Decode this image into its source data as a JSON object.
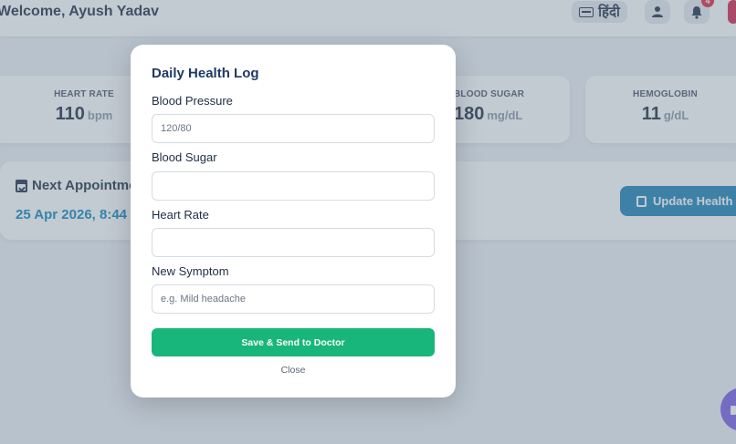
{
  "header": {
    "welcome": "Welcome, Ayush Yadav",
    "language_label": "हिंदी",
    "notification_count": "4"
  },
  "stats": [
    {
      "title": "HEART RATE",
      "value": "110",
      "unit": "bpm"
    },
    {
      "title": "BLOOD SUGAR",
      "value": "180",
      "unit": "mg/dL"
    },
    {
      "title": "HEMOGLOBIN",
      "value": "11",
      "unit": "g/dL"
    }
  ],
  "appointment": {
    "title": "Next Appointment",
    "date": "25 Apr 2026, 8:44"
  },
  "update_button": "Update Health",
  "modal": {
    "title": "Daily Health Log",
    "fields": [
      {
        "label": "Blood Pressure",
        "placeholder": "120/80"
      },
      {
        "label": "Blood Sugar",
        "placeholder": ""
      },
      {
        "label": "Heart Rate",
        "placeholder": ""
      },
      {
        "label": "New Symptom",
        "placeholder": "e.g. Mild headache"
      }
    ],
    "submit_label": "Save & Send to Doctor",
    "close_label": "Close"
  },
  "colors": {
    "primary": "#1c82b5",
    "success": "#18b67a",
    "heading": "#1f3a63",
    "danger": "#e0263c",
    "fab": "#7c5ce6"
  },
  "icons": [
    "keyboard-icon",
    "user-icon",
    "bell-icon",
    "calendar-check-icon",
    "edit-icon",
    "chat-icon"
  ]
}
